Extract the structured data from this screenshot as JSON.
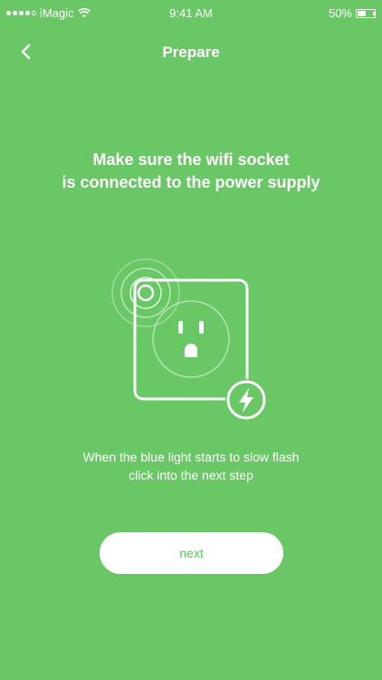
{
  "status_bar": {
    "carrier": "iMagic",
    "time": "9:41 AM",
    "battery_percent": "50%",
    "battery_level": 0.5,
    "signal_bars_filled": 4,
    "signal_bars_total": 5
  },
  "nav": {
    "title": "Prepare",
    "back_icon": "chevron-left-icon"
  },
  "content": {
    "heading_line1": "Make sure the wifi socket",
    "heading_line2": "is connected to the power supply",
    "hint_line1": "When the blue light starts to slow flash",
    "hint_line2": "click into the next step",
    "illustration_icons": [
      "power-socket-icon",
      "indicator-light-icon",
      "lightning-bolt-icon"
    ]
  },
  "actions": {
    "next_label": "next"
  },
  "colors": {
    "background": "#6ac765",
    "foreground": "#ffffff",
    "button_text": "#5cc05a"
  }
}
